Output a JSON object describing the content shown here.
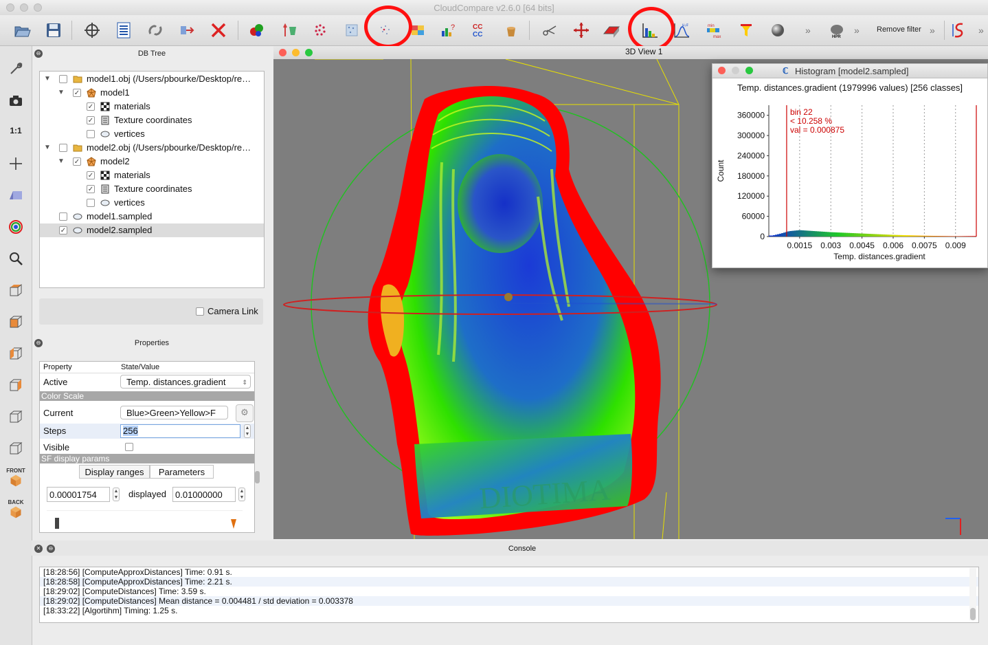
{
  "window": {
    "title": "CloudCompare v2.6.0 [64 bits]"
  },
  "toolbar": {
    "icons": [
      "open-icon",
      "save-icon",
      "pick-icon",
      "list-icon",
      "link-icon",
      "segment-icon",
      "delete-icon",
      "merge-icon",
      "align-icon",
      "sample-icon",
      "subsample-icon",
      "noise-icon",
      "color-icon",
      "stats-icon",
      "compare-icon",
      "bucket-icon",
      "scissors-icon",
      "move-icon",
      "plane-icon",
      "histogram-icon",
      "gaussian-icon",
      "minmax-icon",
      "filter-icon",
      "sphere-icon",
      "hpr-icon",
      "sf-icon"
    ],
    "remove_filter": "Remove filter",
    "more": "»",
    "hpr_label": "HPR",
    "stat_label_mu": "μ,σ",
    "stat_label_min": "min",
    "stat_label_max": "max",
    "compare_label": "CC"
  },
  "left_toolbar": {
    "icons": [
      "wrench-icon",
      "camera-icon",
      "one-to-one-icon",
      "crosshair-icon",
      "perspective-icon",
      "rotation-center-icon",
      "zoom-icon",
      "view-top-icon",
      "view-front-icon",
      "view-left-icon",
      "view-right-icon",
      "view-bottom-icon",
      "view-iso-front-icon",
      "view-iso-back-icon"
    ],
    "one_to_one": "1:1",
    "front_label": "FRONT",
    "back_label": "BACK"
  },
  "db_tree": {
    "title": "DB Tree",
    "items": [
      {
        "label": "model1.obj (/Users/pbourke/Desktop/re…",
        "checked": false,
        "icon": "folder-icon"
      },
      {
        "label": "model1",
        "checked": true,
        "icon": "mesh-icon"
      },
      {
        "label": "materials",
        "checked": true,
        "icon": "materials-icon"
      },
      {
        "label": "Texture coordinates",
        "checked": true,
        "icon": "texcoords-icon"
      },
      {
        "label": "vertices",
        "checked": false,
        "icon": "cloud-icon"
      },
      {
        "label": "model2.obj (/Users/pbourke/Desktop/re…",
        "checked": false,
        "icon": "folder-icon"
      },
      {
        "label": "model2",
        "checked": true,
        "icon": "mesh-icon"
      },
      {
        "label": "materials",
        "checked": true,
        "icon": "materials-icon"
      },
      {
        "label": "Texture coordinates",
        "checked": true,
        "icon": "texcoords-icon"
      },
      {
        "label": "vertices",
        "checked": false,
        "icon": "cloud-icon"
      },
      {
        "label": "model1.sampled",
        "checked": false,
        "icon": "cloud-icon"
      },
      {
        "label": "model2.sampled",
        "checked": true,
        "icon": "cloud-icon"
      }
    ],
    "camera_link": "Camera Link"
  },
  "properties": {
    "title": "Properties",
    "col_property": "Property",
    "col_value": "State/Value",
    "active_label": "Active",
    "active_value": "Temp. distances.gradient",
    "color_scale": "Color Scale",
    "current_label": "Current",
    "current_value": "Blue>Green>Yellow>F",
    "steps_label": "Steps",
    "steps_value": "256",
    "visible_label": "Visible",
    "sf_params": "SF display params",
    "tab_ranges": "Display ranges",
    "tab_params": "Parameters",
    "min_value": "0.00001754",
    "displayed_label": "displayed",
    "max_value": "0.01000000"
  },
  "view3d": {
    "title": "3D View 1",
    "engraving": "DIOTIMA"
  },
  "histogram": {
    "title": "Histogram [model2.sampled]",
    "heading": "Temp. distances.gradient (1979996 values)  [256 classes]",
    "ylabel": "Count",
    "xlabel": "Temp. distances.gradient",
    "yticks": [
      "360000",
      "300000",
      "240000",
      "180000",
      "120000",
      "60000",
      "0"
    ],
    "xticks": [
      "0.0015",
      "0.003",
      "0.0045",
      "0.006",
      "0.0075",
      "0.009"
    ],
    "annotation": [
      "bin 22",
      "< 10.258 %",
      "val = 0.000875"
    ]
  },
  "chart_data": {
    "type": "bar",
    "title": "Temp. distances.gradient (1979996 values)  [256 classes]",
    "xlabel": "Temp. distances.gradient",
    "ylabel": "Count",
    "xlim": [
      1.754e-05,
      0.01
    ],
    "ylim": [
      0,
      390000
    ],
    "selected_bin": 22,
    "selected_value": 0.000875,
    "selected_percent": 10.258,
    "profile": [
      {
        "x": 0.0002,
        "y": 3000
      },
      {
        "x": 0.0006,
        "y": 9000
      },
      {
        "x": 0.001,
        "y": 16000
      },
      {
        "x": 0.0015,
        "y": 19000
      },
      {
        "x": 0.002,
        "y": 17000
      },
      {
        "x": 0.003,
        "y": 13000
      },
      {
        "x": 0.0045,
        "y": 9000
      },
      {
        "x": 0.006,
        "y": 5000
      },
      {
        "x": 0.0075,
        "y": 2500
      },
      {
        "x": 0.009,
        "y": 1000
      },
      {
        "x": 0.0099,
        "y": 1500
      }
    ]
  },
  "console": {
    "title": "Console",
    "lines": [
      "[18:28:56] [ComputeApproxDistances] Time: 0.91 s.",
      "[18:28:58] [ComputeApproxDistances] Time: 2.21 s.",
      "[18:29:02] [ComputeDistances] Time: 3.59 s.",
      "[18:29:02] [ComputeDistances] Mean distance = 0.004481 / std deviation = 0.003378",
      "[18:33:22] [Algortihm] Timing: 1.25 s."
    ]
  },
  "colors": {
    "accent_red": "#ff1010",
    "scalar_red": "#ff0000",
    "scalar_green": "#2ee000",
    "scalar_blue": "#1030d0",
    "viewport_bg": "#7e7e7e"
  }
}
